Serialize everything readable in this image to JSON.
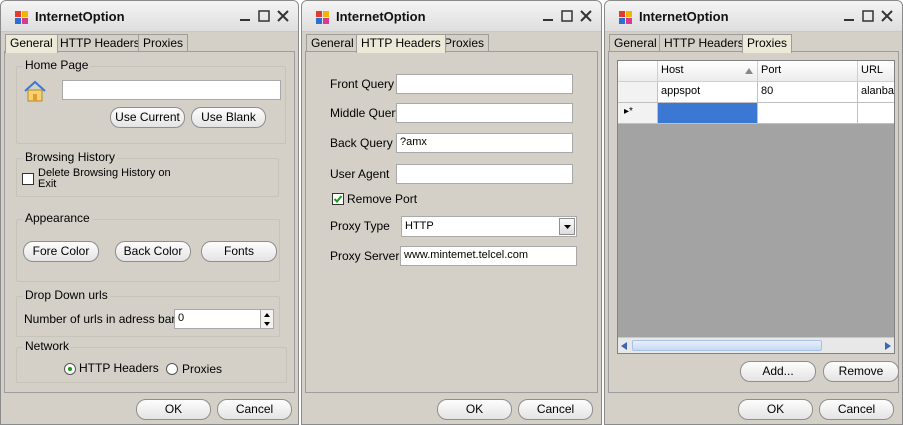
{
  "window_title": "InternetOption",
  "tabs": [
    "General",
    "HTTP Headers",
    "Proxies"
  ],
  "buttons": {
    "ok": "OK",
    "cancel": "Cancel"
  },
  "general": {
    "home_page": {
      "label": "Home Page",
      "value": "",
      "use_current": "Use Current",
      "use_blank": "Use Blank"
    },
    "browsing_history": {
      "label": "Browsing History",
      "delete_checkbox": "Delete Browsing History on Exit",
      "checked": false
    },
    "appearance": {
      "label": "Appearance",
      "fore_color": "Fore Color",
      "back_color": "Back Color",
      "fonts": "Fonts"
    },
    "drop_down": {
      "label": "Drop Down urls",
      "count_label": "Number of urls in adress bar",
      "count_value": "0"
    },
    "network": {
      "label": "Network",
      "options": [
        "HTTP Headers",
        "Proxies"
      ],
      "selected": "HTTP Headers"
    }
  },
  "http_headers": {
    "front_query": {
      "label": "Front Query",
      "value": ""
    },
    "middle_query": {
      "label": "Middle Query",
      "value": ""
    },
    "back_query": {
      "label": "Back Query",
      "value": "?amx"
    },
    "user_agent": {
      "label": "User Agent",
      "value": ""
    },
    "remove_port": {
      "label": "Remove Port",
      "checked": true
    },
    "proxy_type": {
      "label": "Proxy Type",
      "value": "HTTP"
    },
    "proxy_server": {
      "label": "Proxy Server",
      "value": "www.mintemet.telcel.com"
    }
  },
  "proxies": {
    "columns": [
      "Host",
      "Port",
      "URL"
    ],
    "rows": [
      {
        "host": "appspot",
        "port": "80",
        "url": "alanba"
      }
    ],
    "new_row_marker": "▸*",
    "add": "Add...",
    "remove": "Remove"
  },
  "colors": {
    "accent_selected": "#3a78d4",
    "check_green": "#1a9a1a"
  }
}
